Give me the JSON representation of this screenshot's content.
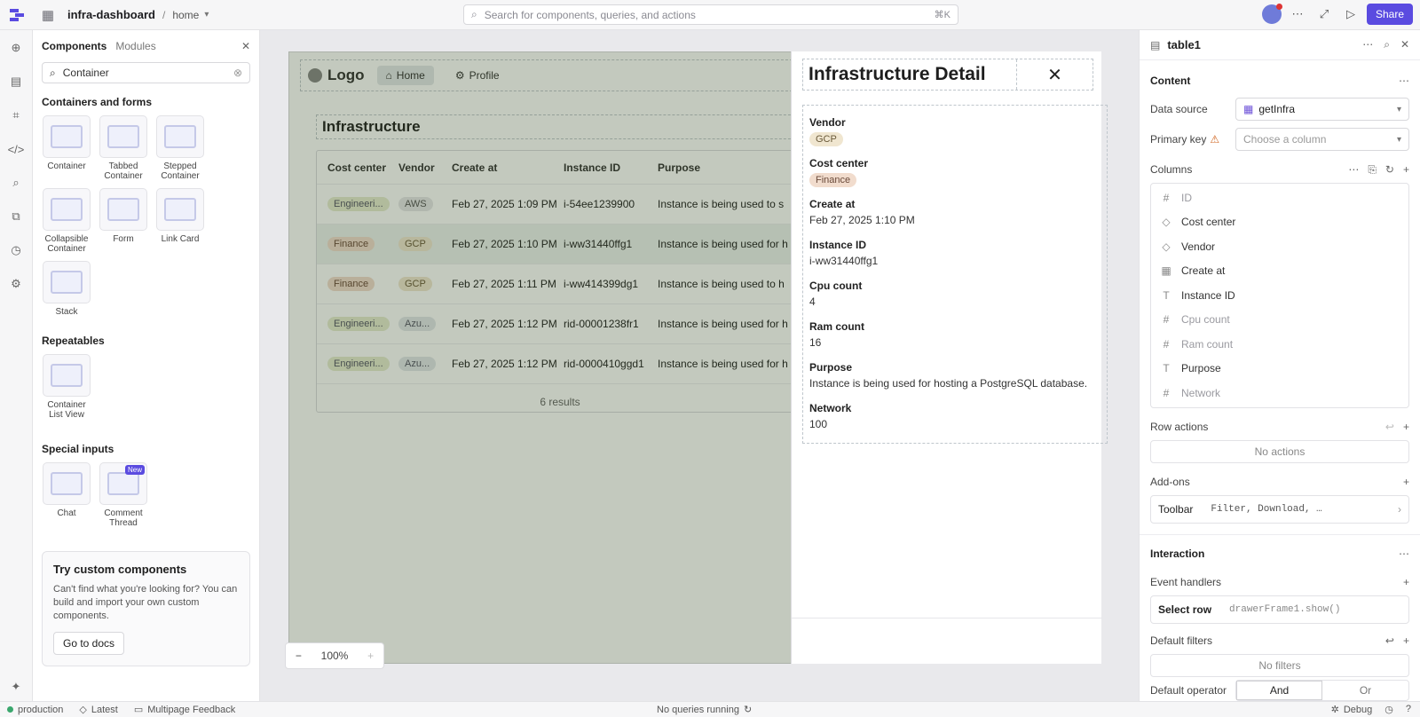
{
  "topbar": {
    "app_name": "infra-dashboard",
    "crumb_sep": "/",
    "page_name": "home",
    "search_placeholder": "Search for components, queries, and actions",
    "search_shortcut": "⌘K",
    "share_label": "Share"
  },
  "left_panel": {
    "tab_components": "Components",
    "tab_modules": "Modules",
    "search_value": "Container",
    "section_containers": "Containers and forms",
    "containers": [
      {
        "label": "Container"
      },
      {
        "label": "Tabbed Container"
      },
      {
        "label": "Stepped Container"
      },
      {
        "label": "Collapsible Container"
      },
      {
        "label": "Form"
      },
      {
        "label": "Link Card"
      },
      {
        "label": "Stack"
      }
    ],
    "section_repeatables": "Repeatables",
    "repeatables": [
      {
        "label": "Container List View"
      }
    ],
    "section_special": "Special inputs",
    "special": [
      {
        "label": "Chat"
      },
      {
        "label": "Comment Thread",
        "badge": "New"
      }
    ],
    "promo_title": "Try custom components",
    "promo_text": "Can't find what you're looking for? You can build and import your own custom components.",
    "promo_button": "Go to docs"
  },
  "canvas": {
    "logo": "Logo",
    "nav_home": "Home",
    "nav_profile": "Profile",
    "infra_title": "Infrastructure",
    "table": {
      "headers": [
        "Cost center",
        "Vendor",
        "Create at",
        "Instance ID",
        "Purpose"
      ],
      "rows": [
        {
          "cost": "Engineeri...",
          "vendor": "AWS",
          "created": "Feb 27, 2025 1:09 PM",
          "id": "i-54ee1239900",
          "purpose": "Instance is being used to s"
        },
        {
          "cost": "Finance",
          "vendor": "GCP",
          "created": "Feb 27, 2025 1:10 PM",
          "id": "i-ww31440ffg1",
          "purpose": "Instance is being used for h"
        },
        {
          "cost": "Finance",
          "vendor": "GCP",
          "created": "Feb 27, 2025 1:11 PM",
          "id": "i-ww414399dg1",
          "purpose": "Instance is being used to h"
        },
        {
          "cost": "Engineeri...",
          "vendor": "Azu...",
          "created": "Feb 27, 2025 1:12 PM",
          "id": "rid-00001238fr1",
          "purpose": "Instance is being used for h"
        },
        {
          "cost": "Engineeri...",
          "vendor": "Azu...",
          "created": "Feb 27, 2025 1:12 PM",
          "id": "rid-0000410ggd1",
          "purpose": "Instance is being used for h"
        }
      ],
      "footer": "6 results"
    },
    "zoom": "100%",
    "drawer": {
      "title": "Infrastructure Detail",
      "fields": [
        {
          "label": "Vendor",
          "value": "GCP",
          "tag": "gcp"
        },
        {
          "label": "Cost center",
          "value": "Finance",
          "tag": "fin"
        },
        {
          "label": "Create at",
          "value": "Feb 27, 2025 1:10 PM"
        },
        {
          "label": "Instance ID",
          "value": "i-ww31440ffg1"
        },
        {
          "label": "Cpu count",
          "value": "4"
        },
        {
          "label": "Ram count",
          "value": "16"
        },
        {
          "label": "Purpose",
          "value": "Instance is being used for hosting a PostgreSQL database."
        },
        {
          "label": "Network",
          "value": "100"
        }
      ]
    }
  },
  "right_panel": {
    "component_name": "table1",
    "section_content": "Content",
    "data_source_label": "Data source",
    "data_source_value": "getInfra",
    "primary_key_label": "Primary key",
    "primary_key_placeholder": "Choose a column",
    "columns_label": "Columns",
    "columns": [
      {
        "name": "ID",
        "icon": "#",
        "dim": true
      },
      {
        "name": "Cost center",
        "icon": "tag",
        "dim": false
      },
      {
        "name": "Vendor",
        "icon": "tag",
        "dim": false
      },
      {
        "name": "Create at",
        "icon": "cal",
        "dim": false
      },
      {
        "name": "Instance ID",
        "icon": "T",
        "dim": false
      },
      {
        "name": "Cpu count",
        "icon": "#",
        "dim": true
      },
      {
        "name": "Ram count",
        "icon": "#",
        "dim": true
      },
      {
        "name": "Purpose",
        "icon": "T",
        "dim": false
      },
      {
        "name": "Network",
        "icon": "#",
        "dim": true
      }
    ],
    "row_actions_label": "Row actions",
    "row_actions_empty": "No actions",
    "addons_label": "Add-ons",
    "toolbar_label": "Toolbar",
    "toolbar_value": "Filter, Download, …",
    "interaction_label": "Interaction",
    "event_handlers_label": "Event handlers",
    "event_name": "Select row",
    "event_action": "drawerFrame1.show()",
    "default_filters_label": "Default filters",
    "default_filters_empty": "No filters",
    "default_operator_label": "Default operator",
    "op_and": "And",
    "op_or": "Or"
  },
  "statusbar": {
    "env": "production",
    "version": "Latest",
    "feedback": "Multipage Feedback",
    "queries": "No queries running",
    "debug": "Debug"
  }
}
